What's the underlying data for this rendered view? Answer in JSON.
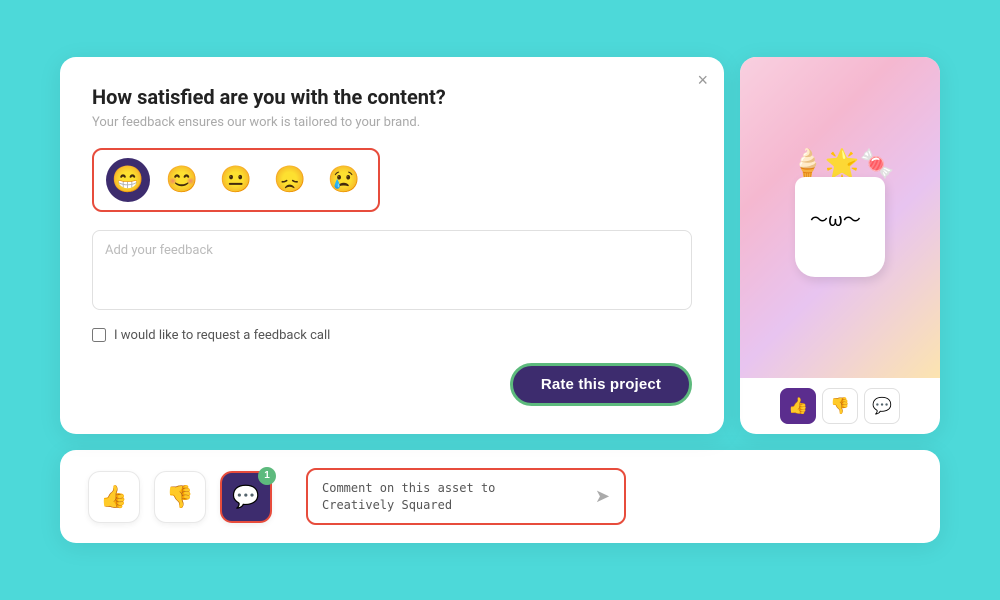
{
  "feedback": {
    "title": "How satisfied are you with the content?",
    "subtitle": "Your feedback ensures our work is tailored to your brand.",
    "close_label": "×",
    "emojis": [
      {
        "id": "very-happy",
        "symbol": "😁",
        "selected": true
      },
      {
        "id": "happy",
        "symbol": "😊",
        "selected": false
      },
      {
        "id": "neutral",
        "symbol": "😐",
        "selected": false
      },
      {
        "id": "sad",
        "symbol": "😞",
        "selected": false
      },
      {
        "id": "very-sad",
        "symbol": "😢",
        "selected": false
      }
    ],
    "textarea_placeholder": "Add your feedback",
    "checkbox_label": "I would like to request a feedback call",
    "rate_button": "Rate this project"
  },
  "image_actions": {
    "thumbs_up": "👍",
    "thumbs_down": "👎",
    "comment": "💬"
  },
  "bottom": {
    "thumbs_up": "👍",
    "thumbs_down": "👎",
    "comment": "💬",
    "badge": "1",
    "comment_placeholder": "Comment on this asset to\nCreatively Squared",
    "send_icon": "➤"
  }
}
